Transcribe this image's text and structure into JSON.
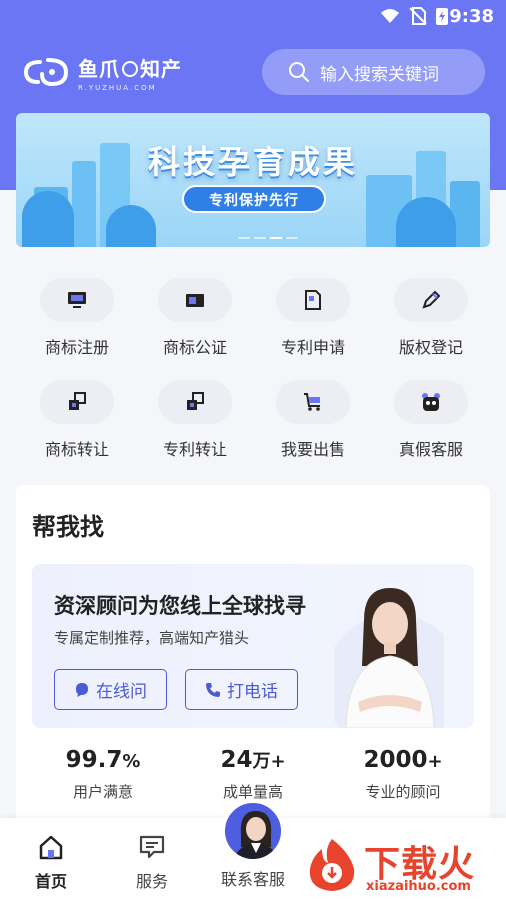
{
  "status": {
    "time": "9:38"
  },
  "header": {
    "logo_name": "鱼爪",
    "logo_name2": "知产",
    "logo_sub": "R.YUZHUA.COM",
    "search_placeholder": "输入搜索关键词"
  },
  "banner": {
    "title": "科技孕育成果",
    "subtitle": "专利保护先行",
    "page_count": 4,
    "active_page": 3
  },
  "services": [
    {
      "label": "商标注册",
      "icon": "monitor-icon"
    },
    {
      "label": "商标公证",
      "icon": "certificate-icon"
    },
    {
      "label": "专利申请",
      "icon": "document-icon"
    },
    {
      "label": "版权登记",
      "icon": "pen-icon"
    },
    {
      "label": "商标转让",
      "icon": "transfer-icon"
    },
    {
      "label": "专利转让",
      "icon": "patent-transfer-icon"
    },
    {
      "label": "我要出售",
      "icon": "cart-icon"
    },
    {
      "label": "真假客服",
      "icon": "mascot-icon"
    }
  ],
  "help": {
    "title": "帮我找",
    "promo_title": "资深顾问为您线上全球找寻",
    "promo_sub": "专属定制推荐，高端知产猎头",
    "btn_chat": "在线问",
    "btn_call": "打电话"
  },
  "stats": [
    {
      "num": "99.7",
      "unit": "%",
      "cap": "用户满意"
    },
    {
      "num": "24",
      "unit": "万+",
      "cap": "成单量高"
    },
    {
      "num": "2000",
      "unit": "+",
      "cap": "专业的顾问"
    }
  ],
  "tabs": [
    {
      "label": "首页",
      "icon": "home-icon"
    },
    {
      "label": "服务",
      "icon": "chat-icon"
    },
    {
      "label": "联系客服",
      "icon": "agent-avatar"
    }
  ],
  "watermark": {
    "text": "下载火",
    "url": "xiazaihuo.com"
  },
  "colors": {
    "primary": "#6a76f3",
    "accent": "#4b5bd6",
    "watermark": "#e8432c"
  }
}
